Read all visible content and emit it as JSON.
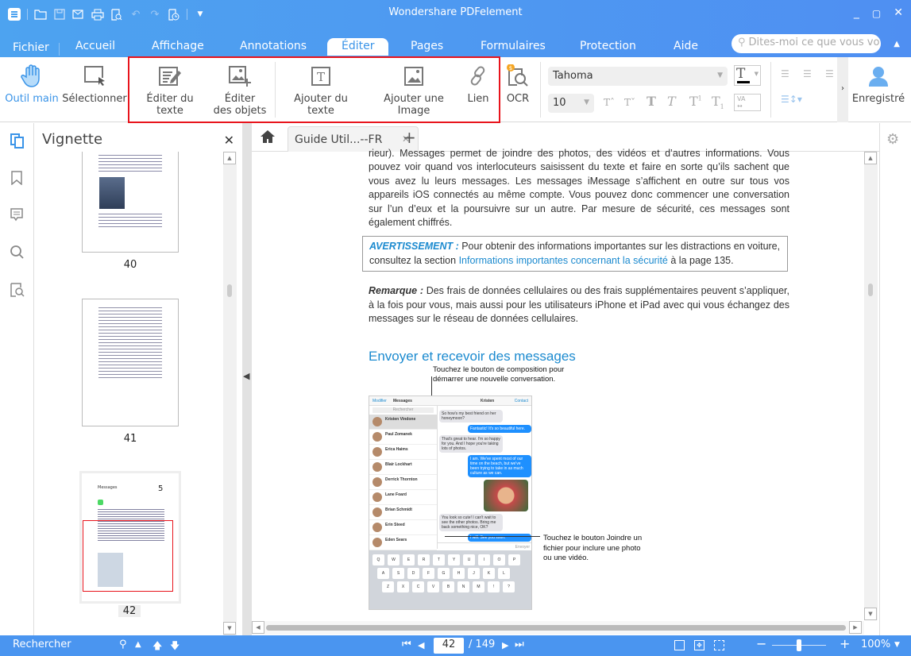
{
  "app": {
    "title": "Wondershare PDFelement"
  },
  "quick_access": {
    "icons": [
      "app-menu-icon",
      "open-folder-icon",
      "save-icon",
      "email-icon",
      "print-icon",
      "print-preview-icon",
      "undo-icon",
      "redo-icon",
      "history-icon",
      "customize-icon"
    ]
  },
  "menu_tabs": [
    {
      "label": "Fichier"
    },
    {
      "label": "Accueil"
    },
    {
      "label": "Affichage"
    },
    {
      "label": "Annotations"
    },
    {
      "label": "Éditer",
      "active": true
    },
    {
      "label": "Pages"
    },
    {
      "label": "Formulaires"
    },
    {
      "label": "Protection"
    },
    {
      "label": "Aide"
    }
  ],
  "search": {
    "placeholder": "Dites-moi ce que vous vo"
  },
  "ribbon": {
    "buttons": [
      {
        "label": "Outil main",
        "icon": "hand-icon",
        "active": true
      },
      {
        "label": "Sélectionner",
        "icon": "select-icon"
      },
      {
        "label": "Éditer du texte",
        "icon": "edit-text-icon"
      },
      {
        "label": "Éditer",
        "label2": "des objets",
        "icon": "edit-objects-icon"
      },
      {
        "label": "Ajouter du texte",
        "icon": "add-text-icon"
      },
      {
        "label": "Ajouter une Image",
        "icon": "add-image-icon"
      },
      {
        "label": "Lien",
        "icon": "link-icon"
      },
      {
        "label": "OCR",
        "icon": "ocr-icon"
      }
    ],
    "font_name": "Tahoma",
    "font_size": "10",
    "account_label": "Enregistré"
  },
  "thumbnails": {
    "title": "Vignette",
    "pages": [
      {
        "number": "40"
      },
      {
        "number": "41"
      },
      {
        "number": "42",
        "selected": true
      }
    ]
  },
  "document": {
    "tab_label": "Guide Util...--FR",
    "paragraph1": "rieur). Messages permet de joindre des photos, des vidéos et d’autres informations. Vous pouvez voir quand vos interlocuteurs saisissent du texte et faire en sorte qu’ils sachent que vous avez lu leurs messages. Les messages iMessage s’affichent en outre sur tous vos appareils iOS connectés au même compte. Vous pouvez donc commencer une conversation sur l’un d’eux et la poursuivre sur un autre. Par mesure de sécurité, ces messages sont également chiffrés.",
    "warning_label": "AVERTISSEMENT :",
    "warning_text": " Pour obtenir des informations importantes sur les distractions en voiture, consultez la section ",
    "warning_link": "Informations importantes concernant la sécurité",
    "warning_tail": " à la page 135.",
    "remark_label": "Remarque :",
    "remark_text": " Des frais de données cellulaires ou des frais supplémentaires peuvent s’appliquer, à la fois pour vous, mais aussi pour les utilisateurs iPhone et iPad avec qui vous échangez des messages sur le réseau de données cellulaires.",
    "heading": "Envoyer et recevoir des messages",
    "callout1": "Touchez le bouton de composition pour démarrer une nouvelle conversation.",
    "callout2": "Touchez le bouton Joindre un fichier pour inclure une photo ou une vidéo.",
    "ipad": {
      "left_header": "Modifier",
      "list_title": "Messages",
      "chat_title": "Kristen",
      "contact": "Contact",
      "search": "Rechercher",
      "send": "Envoyer",
      "contacts": [
        "Kristen Vindone",
        "Paul Zomanek",
        "Erica Haims",
        "Blair Lockhart",
        "Derrick Thornton",
        "Lane Foard",
        "Brian Schmidt",
        "Erin Steed",
        "Eden Sears"
      ],
      "bubbles_in": [
        "So how's my best friend on her honeymoon?",
        "That's great to hear. I'm so happy for you. And I hope you're taking lots of photos.",
        "You look so cute! I can't wait to see the other photos. Bring me back something nice, OK?"
      ],
      "bubbles_out": [
        "Fantastic! It's so beautiful here.",
        "I am. We've spent most of our time on the beach, but we've been trying to take in as much culture as we can.",
        "I will. See you soon."
      ],
      "keys_row1": [
        "Q",
        "W",
        "E",
        "R",
        "T",
        "Y",
        "U",
        "I",
        "O",
        "P"
      ],
      "keys_row2": [
        "A",
        "S",
        "D",
        "F",
        "G",
        "H",
        "J",
        "K",
        "L"
      ],
      "keys_row3": [
        "Z",
        "X",
        "C",
        "V",
        "B",
        "N",
        "M",
        "!",
        "?"
      ]
    }
  },
  "statusbar": {
    "search_label": "Rechercher",
    "current_page": "42",
    "total_pages": "/ 149",
    "zoom": "100%",
    "zoom_slider_fraction": 0.5
  },
  "colors": {
    "accent": "#4a95f0",
    "highlight": "#e8141c",
    "link": "#1b8acf"
  }
}
